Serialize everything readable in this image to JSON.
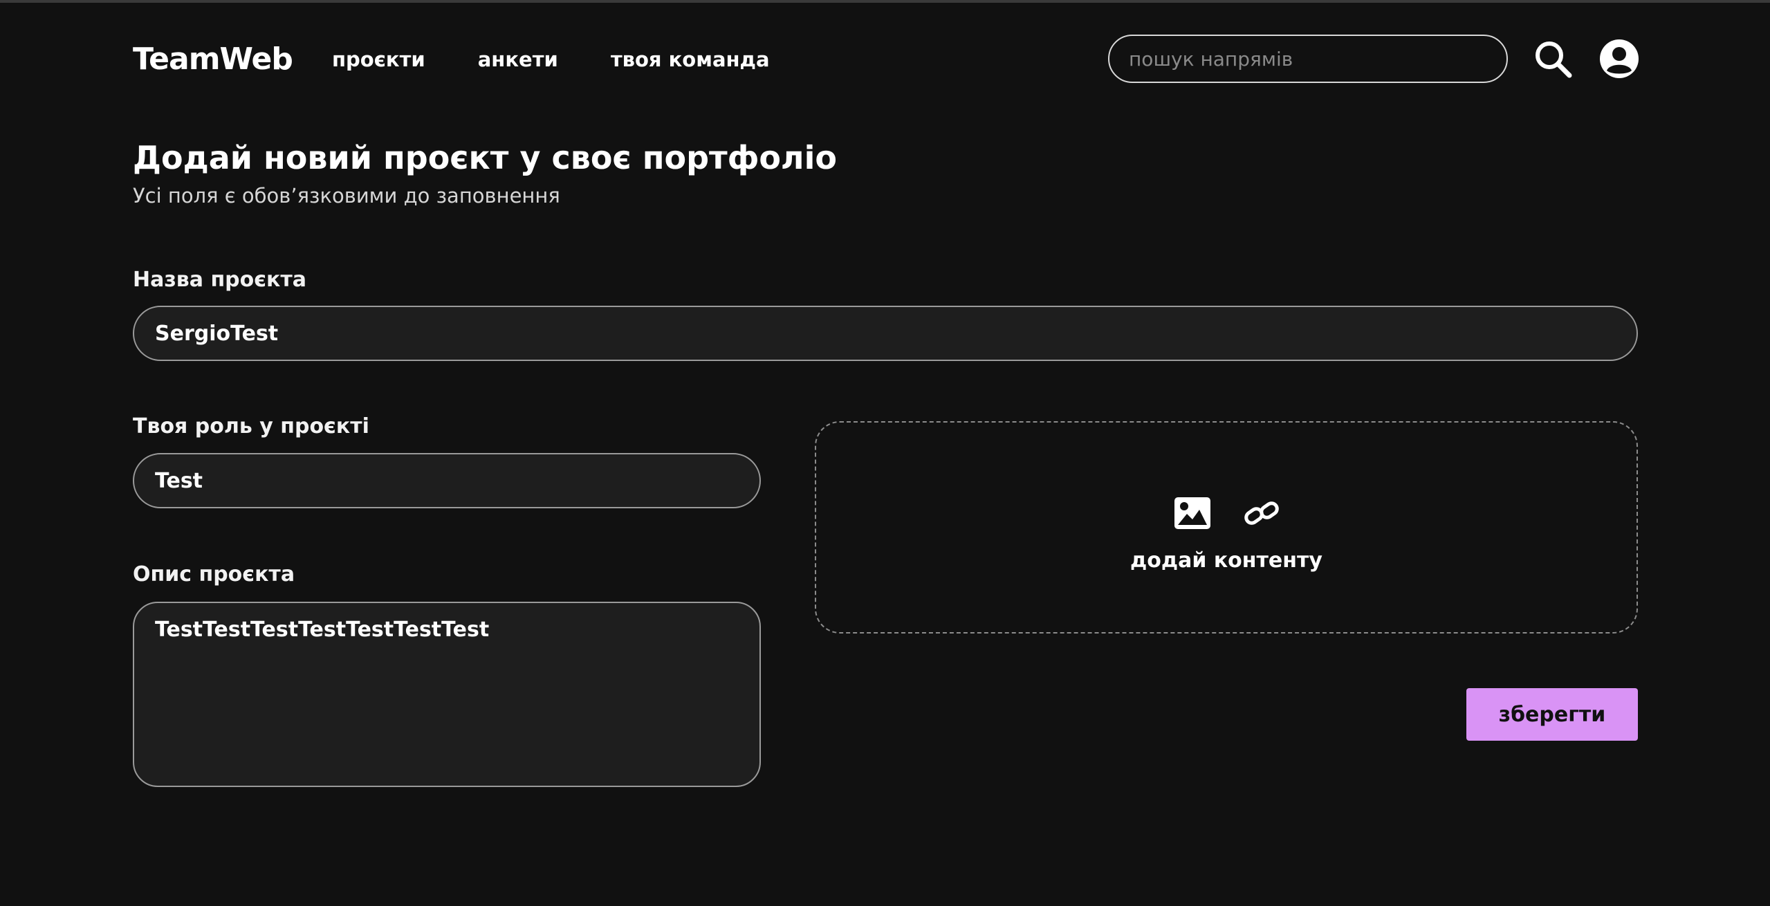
{
  "header": {
    "logo": "TeamWeb",
    "nav": [
      {
        "label": "проєкти"
      },
      {
        "label": "анкети"
      },
      {
        "label": "твоя команда"
      }
    ],
    "search": {
      "placeholder": "пошук напрямів",
      "value": ""
    },
    "icons": {
      "search": "search-icon",
      "user": "user-account-icon"
    }
  },
  "form": {
    "title": "Додай новий проєкт у своє портфоліо",
    "subtitle": "Усі поля є обов’язковими до заповнення",
    "project_name": {
      "label": "Назва проєкта",
      "value": "SergioTest"
    },
    "role": {
      "label": "Твоя роль у проєкті",
      "value": "Test"
    },
    "description": {
      "label": "Опис проєкта",
      "value": "TestTestTestTestTestTestTest"
    },
    "content": {
      "label": "додай контенту",
      "icons": [
        "image-icon",
        "link-icon"
      ]
    },
    "save_label": "зберегти"
  },
  "colors": {
    "background": "#111111",
    "field_background": "#1e1e1e",
    "accent": "#d993f5"
  }
}
